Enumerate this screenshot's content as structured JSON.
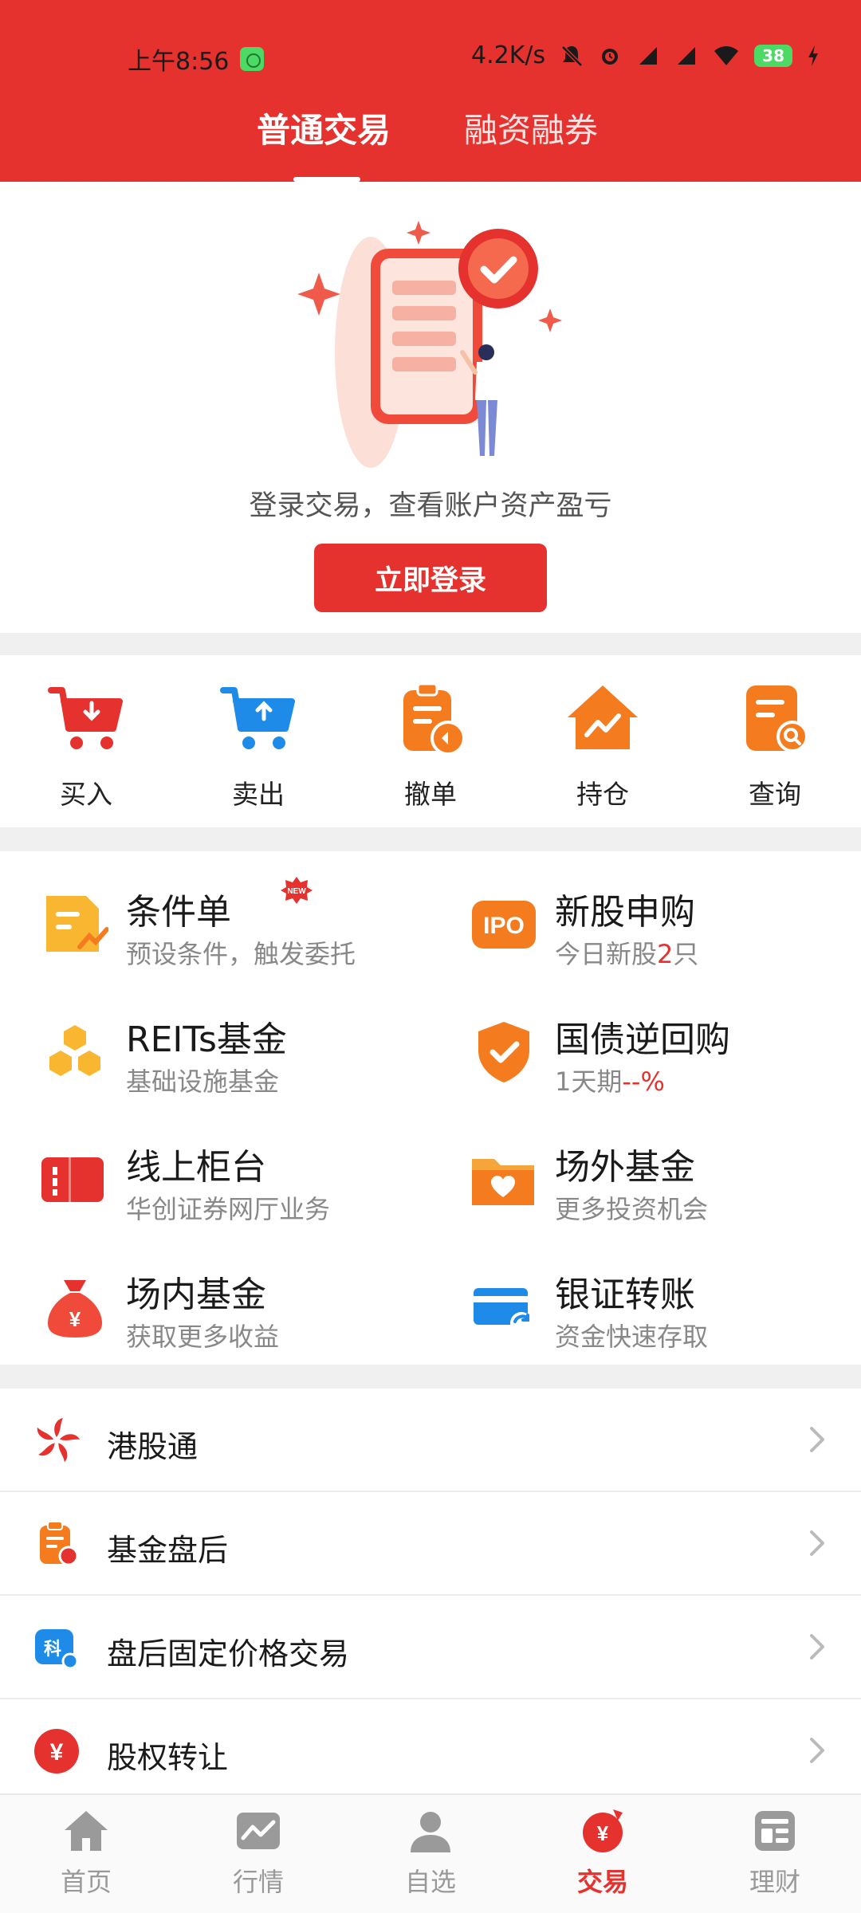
{
  "status": {
    "time": "上午8:56",
    "net_speed": "4.2K/s",
    "battery": "38"
  },
  "tabs": [
    {
      "label": "普通交易",
      "active": true
    },
    {
      "label": "融资融券",
      "active": false
    }
  ],
  "login": {
    "hint": "登录交易，查看账户资产盈亏",
    "button": "立即登录"
  },
  "quick": [
    {
      "label": "买入",
      "icon": "cart-down-icon"
    },
    {
      "label": "卖出",
      "icon": "cart-up-icon"
    },
    {
      "label": "撤单",
      "icon": "clipboard-undo-icon"
    },
    {
      "label": "持仓",
      "icon": "house-chart-icon"
    },
    {
      "label": "查询",
      "icon": "doc-search-icon"
    }
  ],
  "grid": [
    {
      "title": "条件单",
      "sub": "预设条件，触发委托",
      "badge": "NEW"
    },
    {
      "title": "新股申购",
      "sub_prefix": "今日新股",
      "sub_count": "2",
      "sub_suffix": "只",
      "icon_text": "IPO"
    },
    {
      "title": "REITs基金",
      "sub": "基础设施基金"
    },
    {
      "title": "国债逆回购",
      "sub_prefix": "1天期",
      "sub_value": "--%"
    },
    {
      "title": "线上柜台",
      "sub": "华创证券网厅业务"
    },
    {
      "title": "场外基金",
      "sub": "更多投资机会"
    },
    {
      "title": "场内基金",
      "sub": "获取更多收益"
    },
    {
      "title": "银证转账",
      "sub": "资金快速存取"
    }
  ],
  "list": [
    {
      "label": "港股通",
      "icon": "bauhinia-icon"
    },
    {
      "label": "基金盘后",
      "icon": "clipboard-icon"
    },
    {
      "label": "盘后固定价格交易",
      "icon": "star-market-icon",
      "icon_text": "科"
    },
    {
      "label": "股权转让",
      "icon": "yen-circle-icon"
    }
  ],
  "nav": [
    {
      "label": "首页",
      "icon": "home-icon",
      "active": false
    },
    {
      "label": "行情",
      "icon": "market-chart-icon",
      "active": false
    },
    {
      "label": "自选",
      "icon": "person-icon",
      "active": false
    },
    {
      "label": "交易",
      "icon": "trade-yen-icon",
      "active": true
    },
    {
      "label": "理财",
      "icon": "wealth-icon",
      "active": false
    }
  ],
  "colors": {
    "brand_red": "#e5322e",
    "orange": "#f57b1f",
    "blue": "#1e8be8"
  }
}
